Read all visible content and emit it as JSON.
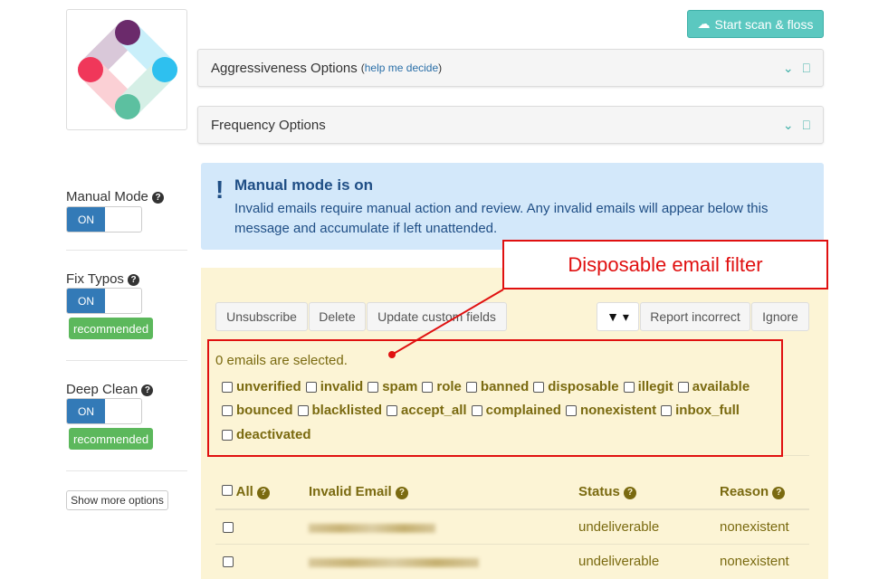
{
  "header": {
    "scan_button": "Start scan & floss"
  },
  "panels": [
    {
      "title": "Aggressiveness Options",
      "help_prefix": "(",
      "help_link": "help me decide",
      "help_suffix": ")"
    },
    {
      "title": "Frequency Options"
    }
  ],
  "sidebar": {
    "toggles": [
      {
        "label": "Manual Mode",
        "state": "ON"
      },
      {
        "label": "Fix Typos",
        "state": "ON",
        "badge": "recommended"
      },
      {
        "label": "Deep Clean",
        "state": "ON",
        "badge": "recommended"
      }
    ],
    "more_button": "Show more options"
  },
  "alert": {
    "title": "Manual mode is on",
    "body": "Invalid emails require manual action and review. Any invalid emails will appear below this message and accumulate if left unattended."
  },
  "toolbar": {
    "unsubscribe": "Unsubscribe",
    "delete": "Delete",
    "update": "Update custom fields",
    "report": "Report incorrect",
    "ignore": "Ignore"
  },
  "selection": "0 emails are selected.",
  "filters": [
    [
      "unverified",
      "invalid",
      "spam",
      "role",
      "banned",
      "disposable",
      "illegit",
      "available"
    ],
    [
      "bounced",
      "blacklisted",
      "accept_all",
      "complained",
      "nonexistent",
      "inbox_full"
    ],
    [
      "deactivated"
    ]
  ],
  "table": {
    "headers": {
      "all": "All",
      "email": "Invalid Email",
      "status": "Status",
      "reason": "Reason"
    },
    "rows": [
      {
        "status": "undeliverable",
        "reason": "nonexistent"
      },
      {
        "status": "undeliverable",
        "reason": "nonexistent"
      }
    ]
  },
  "annotation": "Disposable email filter"
}
